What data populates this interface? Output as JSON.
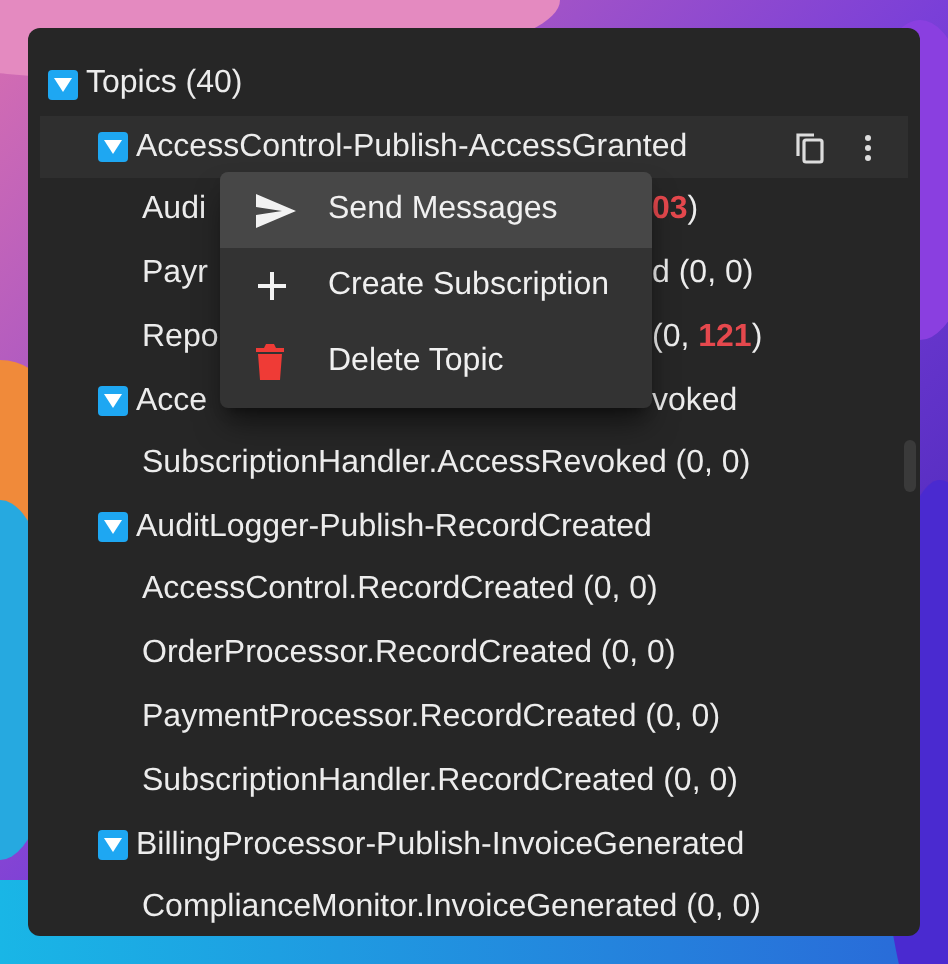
{
  "tree": {
    "label": "Topics (40)",
    "expanded": true,
    "children": [
      {
        "label": "AccessControl-Publish-AccessGranted",
        "expanded": true,
        "selected": true,
        "children": [
          {
            "label_start": "Audi",
            "label_end": [
              {
                "text": "03",
                "alert": true
              },
              {
                "text": ")",
                "alert": false
              }
            ]
          },
          {
            "label_start": "Payr",
            "label_end": [
              {
                "text": "d (0, 0)",
                "alert": false
              }
            ]
          },
          {
            "label_start": "Repo",
            "label_end": [
              {
                "text": "(0, ",
                "alert": false
              },
              {
                "text": "121",
                "alert": true
              },
              {
                "text": ")",
                "alert": false
              }
            ]
          }
        ]
      },
      {
        "label_start": "Acce",
        "label_end": [
          {
            "text": "voked",
            "alert": false
          }
        ],
        "expanded": true,
        "selected": false,
        "children": [
          {
            "label": "SubscriptionHandler.AccessRevoked (0, 0)"
          }
        ]
      },
      {
        "label": "AuditLogger-Publish-RecordCreated",
        "expanded": true,
        "selected": false,
        "children": [
          {
            "label": "AccessControl.RecordCreated (0, 0)"
          },
          {
            "label": "OrderProcessor.RecordCreated (0, 0)"
          },
          {
            "label": "PaymentProcessor.RecordCreated (0, 0)"
          },
          {
            "label": "SubscriptionHandler.RecordCreated (0, 0)"
          }
        ]
      },
      {
        "label": "BillingProcessor-Publish-InvoiceGenerated",
        "expanded": true,
        "selected": false,
        "children": [
          {
            "label": "ComplianceMonitor.InvoiceGenerated (0, 0)"
          }
        ]
      }
    ]
  },
  "context_menu": {
    "items": [
      {
        "label": "Send Messages",
        "kind": "send",
        "selected": true
      },
      {
        "label": "Create Subscription",
        "kind": "add",
        "selected": false
      },
      {
        "label": "Delete Topic",
        "kind": "delete",
        "selected": false
      }
    ]
  }
}
